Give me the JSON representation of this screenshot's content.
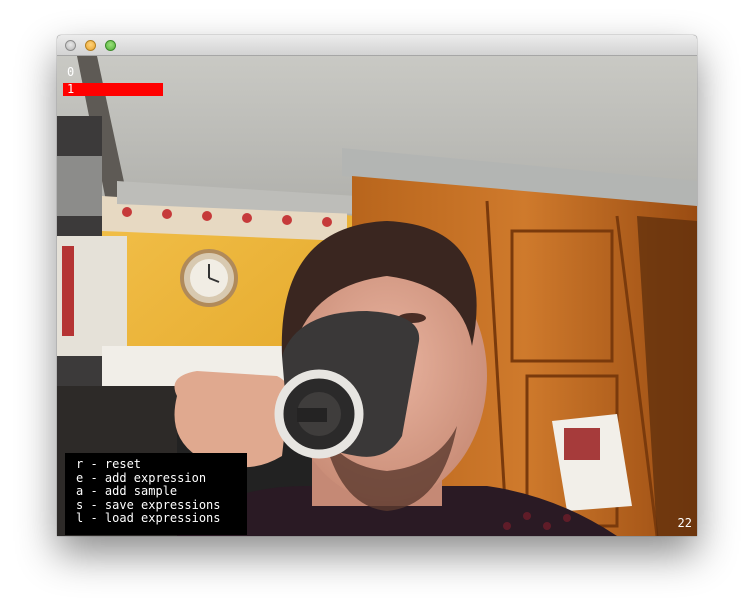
{
  "window": {
    "buttons": [
      "close",
      "minimize",
      "maximize"
    ]
  },
  "expressions": [
    {
      "label": "0",
      "value": 0.0
    },
    {
      "label": "1",
      "value": 1.0
    }
  ],
  "colors": {
    "bar": "#ff0000",
    "panel": "#000000",
    "text": "#ffffff"
  },
  "keys": [
    {
      "text": "r - reset"
    },
    {
      "text": "e - add expression"
    },
    {
      "text": "a - add sample"
    },
    {
      "text": "s - save expressions"
    },
    {
      "text": "l - load expressions"
    }
  ],
  "fps": "22",
  "scene": {
    "description_icon": "webcam-feed-image"
  }
}
